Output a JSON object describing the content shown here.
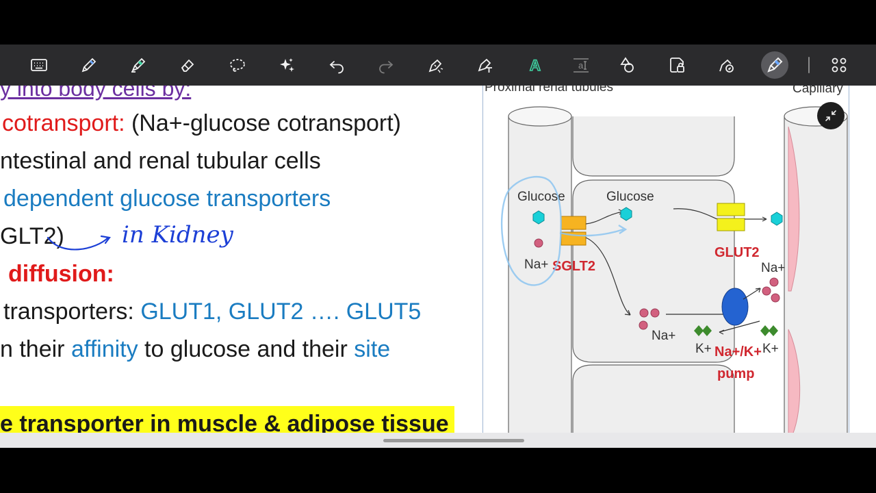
{
  "toolbar": {
    "icons": [
      "keyboard-icon",
      "pen-icon",
      "highlighter-icon",
      "eraser-icon",
      "lasso-icon",
      "ai-sparkle-icon",
      "undo-icon",
      "redo-icon",
      "shape-pen-icon",
      "text-icon",
      "handwriting-text-icon",
      "text-spacing-icon",
      "shapes-icon",
      "lock-page-icon",
      "pen-settings-icon",
      "laser-pen-icon",
      "grid-apps-icon"
    ],
    "active": "laser-pen-icon",
    "spacing_glyph": "a",
    "text_glyph": "T",
    "handwriting_glyph": "A"
  },
  "slide": {
    "heading": "y into body cells by:",
    "line1_red": "cotransport:",
    "line1_black": " (Na+-glucose cotransport)",
    "line2": "ntestinal and renal tubular cells",
    "line3": "dependent glucose transporters",
    "line4": "GLT2)",
    "line5_red": "diffusion:",
    "line6_black": "transporters: ",
    "line6_blue": "GLUT1, GLUT2 …. GLUT5",
    "line7_a": "n their ",
    "line7_b": "affinity",
    "line7_c": " to glucose and their ",
    "line7_d": "site",
    "line8": "e transporter in muscle & adipose tissue"
  },
  "annotation": {
    "handwritten": "in Kidney"
  },
  "diagram": {
    "header_left": "Proximal renal tubules",
    "header_right": "Capillary",
    "glucose_left": "Glucose",
    "glucose_mid": "Glucose",
    "na_left": "Na+",
    "sglt2": "SGLT2",
    "glut2": "GLUT2",
    "na_mid": "Na+",
    "na_right": "Na+",
    "k_left": "K+",
    "k_right": "K+",
    "pump_line1": "Na+/K+",
    "pump_line2": "pump",
    "colors": {
      "glucose": "#19d0d8",
      "sodium": "#d2607f",
      "potassium": "#3d8b2d",
      "pump": "#2463d1",
      "transporter": "#f6b321",
      "glut": "#f4f11c",
      "capillary": "#f6b9c2"
    }
  },
  "collapse": {
    "icon": "collapse-icon"
  }
}
